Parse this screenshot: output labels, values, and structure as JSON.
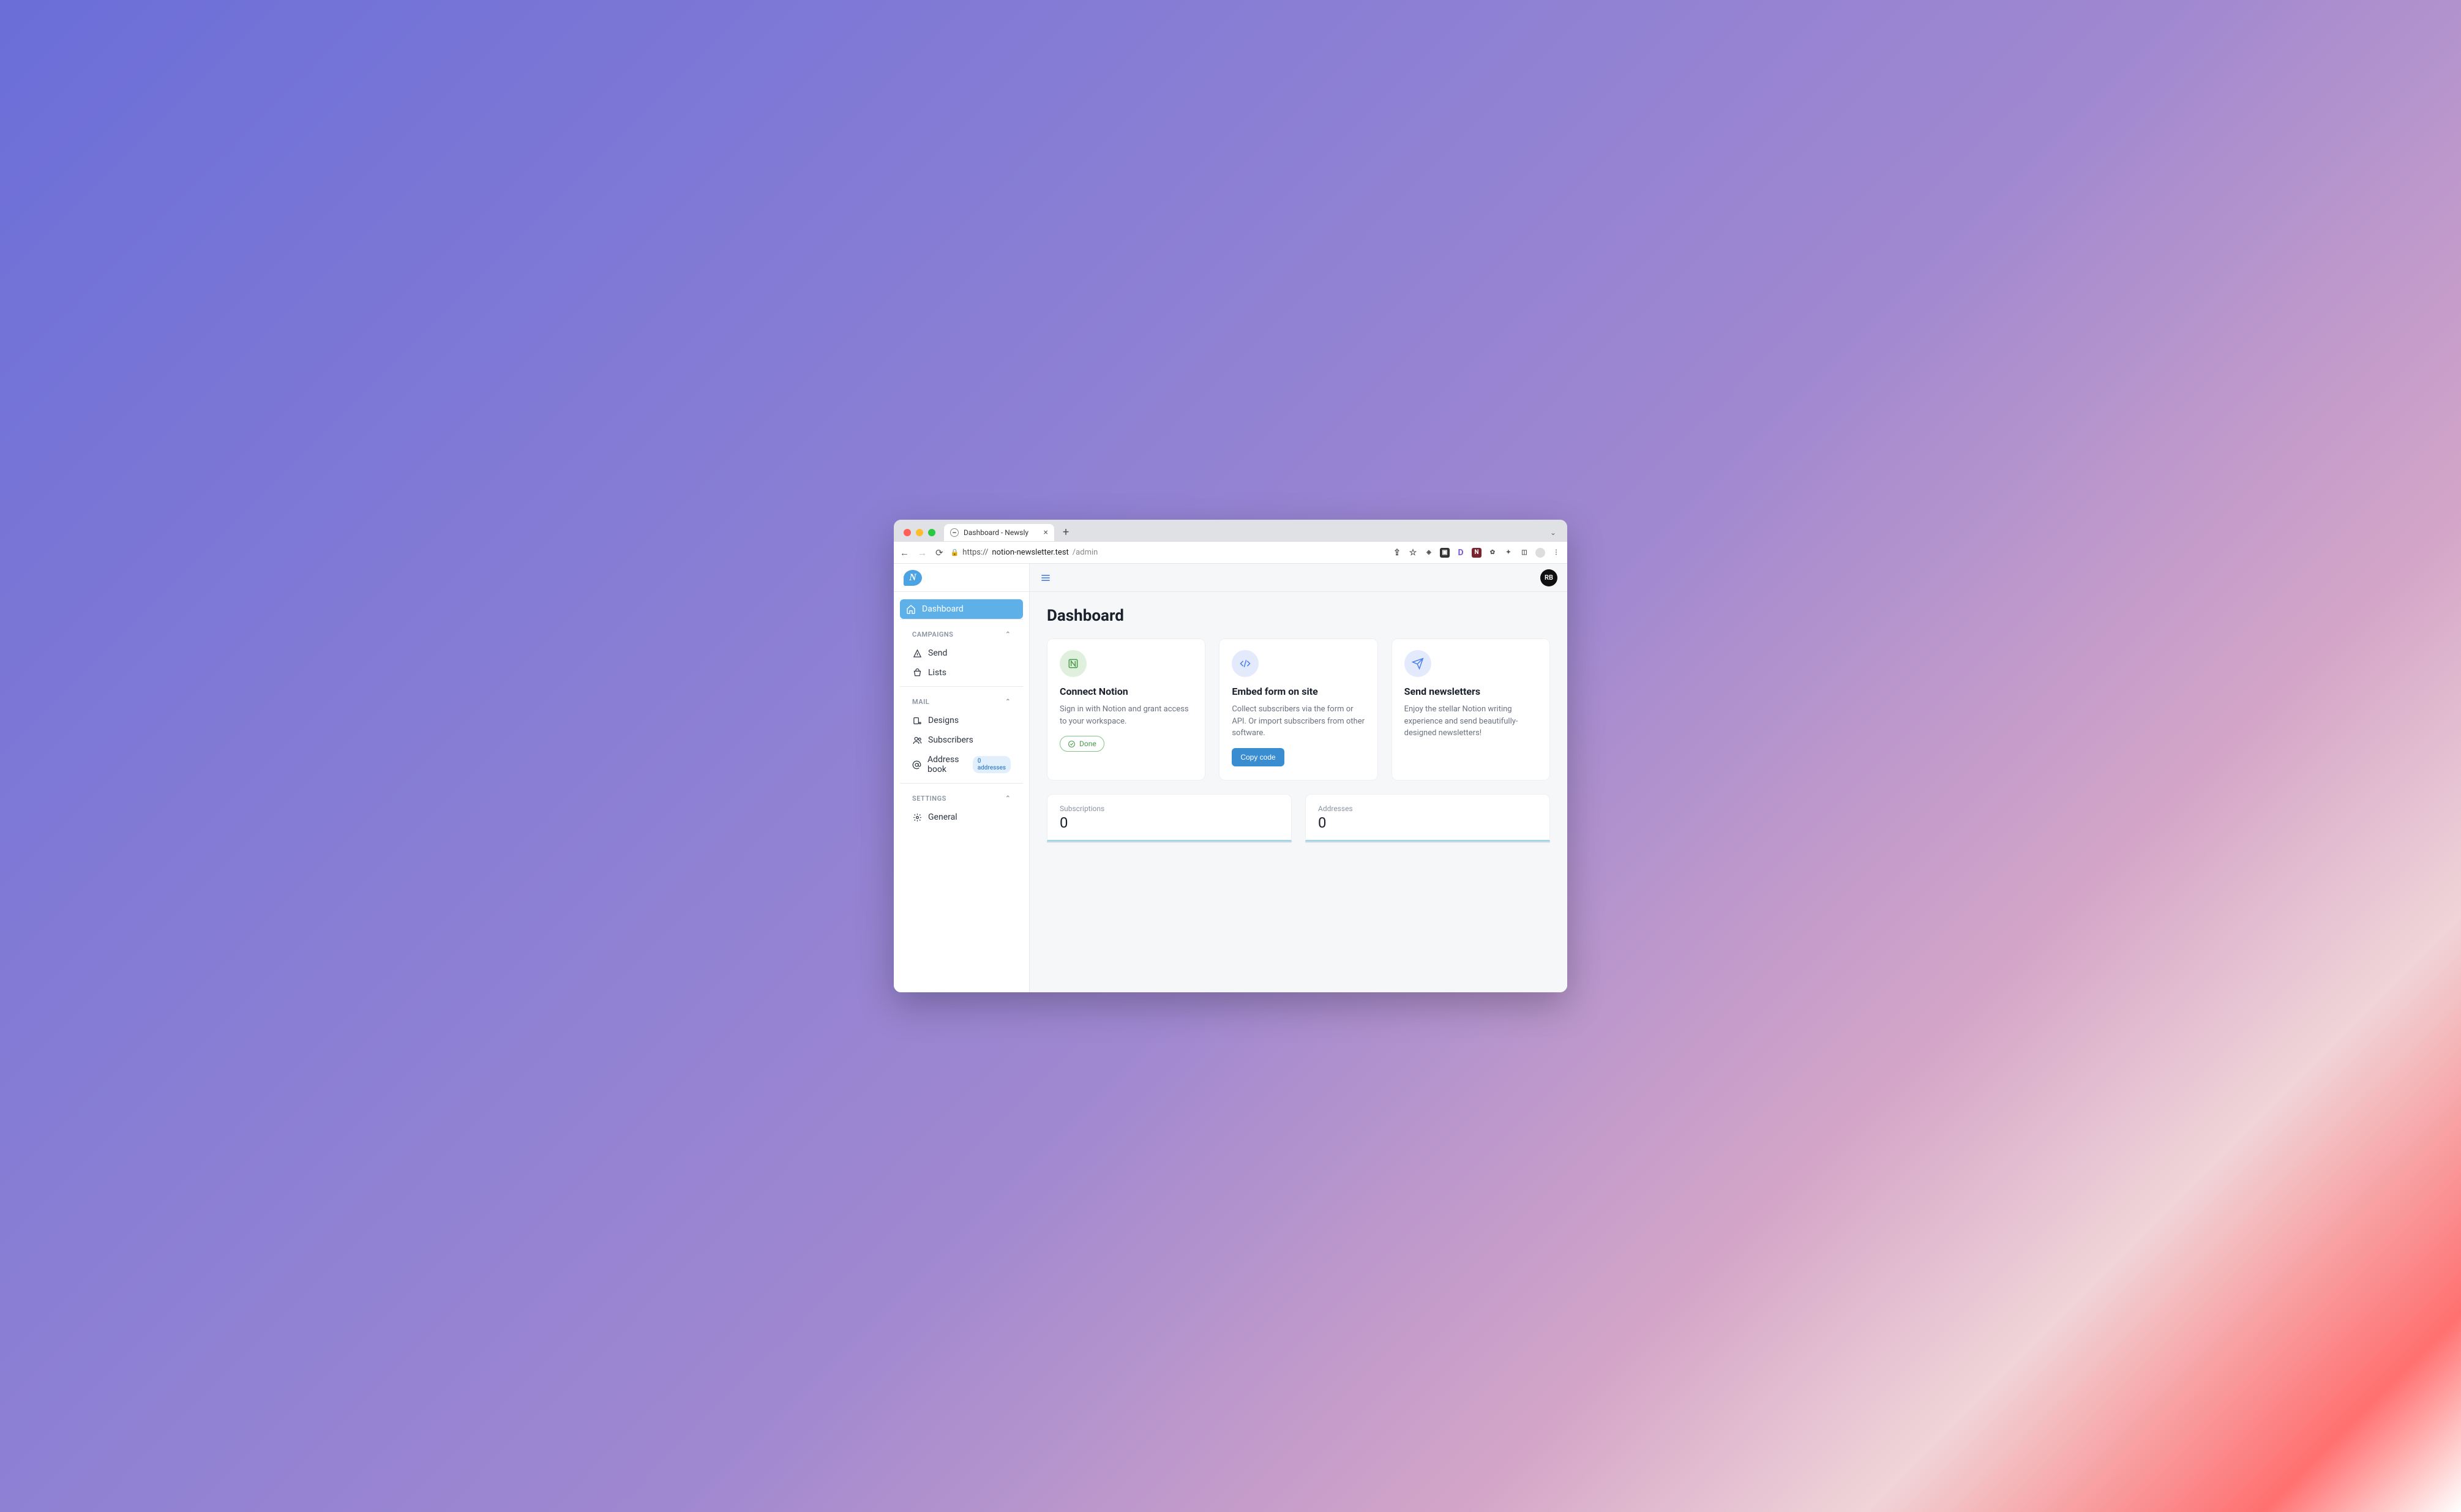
{
  "browser": {
    "tab_title": "Dashboard - Newsly",
    "url_scheme": "https://",
    "url_domain": "notion-newsletter.test",
    "url_path": "/admin"
  },
  "header": {
    "user_initials": "RB"
  },
  "sidebar": {
    "dashboard_label": "Dashboard",
    "campaigns": {
      "header": "CAMPAIGNS",
      "send_label": "Send",
      "lists_label": "Lists"
    },
    "mail": {
      "header": "MAIL",
      "designs_label": "Designs",
      "subscribers_label": "Subscribers",
      "address_book_label": "Address book",
      "address_book_badge": "0 addresses"
    },
    "settings": {
      "header": "SETTINGS",
      "general_label": "General"
    }
  },
  "main": {
    "page_title": "Dashboard",
    "cards": {
      "connect": {
        "title": "Connect Notion",
        "desc": "Sign in with Notion and grant access to your workspace.",
        "done_label": "Done"
      },
      "embed": {
        "title": "Embed form on site",
        "desc": "Collect subscribers via the form or API. Or import subscribers from other software.",
        "button_label": "Copy code"
      },
      "send": {
        "title": "Send newsletters",
        "desc": "Enjoy the stellar Notion writing experience and send beautifully-designed newsletters!"
      }
    },
    "stats": {
      "subscriptions_label": "Subscriptions",
      "subscriptions_value": "0",
      "addresses_label": "Addresses",
      "addresses_value": "0"
    }
  }
}
